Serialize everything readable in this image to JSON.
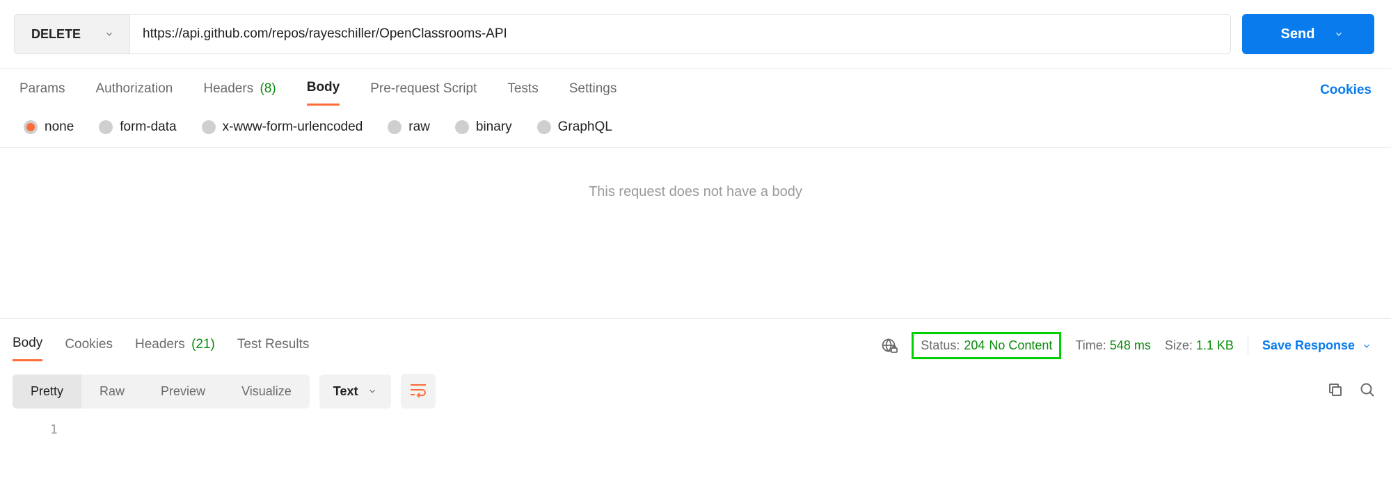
{
  "request": {
    "method": "DELETE",
    "url": "https://api.github.com/repos/rayeschiller/OpenClassrooms-API",
    "send_label": "Send"
  },
  "req_tabs": {
    "params": "Params",
    "authorization": "Authorization",
    "headers": "Headers",
    "headers_count": "(8)",
    "body": "Body",
    "pre_request": "Pre-request Script",
    "tests": "Tests",
    "settings": "Settings",
    "cookies_link": "Cookies"
  },
  "body_types": {
    "none": "none",
    "form_data": "form-data",
    "urlencoded": "x-www-form-urlencoded",
    "raw": "raw",
    "binary": "binary",
    "graphql": "GraphQL"
  },
  "no_body_message": "This request does not have a body",
  "resp_tabs": {
    "body": "Body",
    "cookies": "Cookies",
    "headers": "Headers",
    "headers_count": "(21)",
    "test_results": "Test Results"
  },
  "resp_meta": {
    "status_label": "Status:",
    "status_code": "204",
    "status_text": "No Content",
    "time_label": "Time:",
    "time_value": "548 ms",
    "size_label": "Size:",
    "size_value": "1.1 KB",
    "save_response": "Save Response"
  },
  "view_tabs": {
    "pretty": "Pretty",
    "raw": "Raw",
    "preview": "Preview",
    "visualize": "Visualize"
  },
  "format_select": "Text",
  "line_number": "1"
}
